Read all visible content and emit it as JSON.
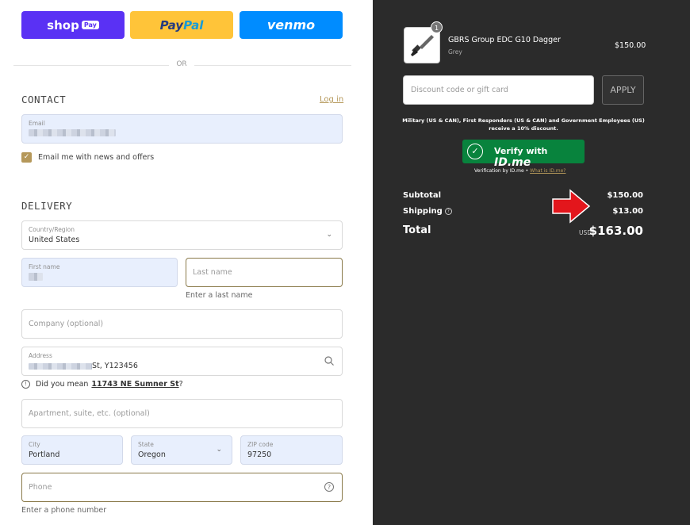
{
  "express": {
    "shop_label": "shop",
    "shop_pay_tag": "Pay",
    "paypal_pay": "Pay",
    "paypal_pal": "Pal",
    "venmo_label": "venmo",
    "or_text": "OR"
  },
  "contact": {
    "title": "CONTACT",
    "login_link": "Log in",
    "email_label": "Email",
    "newsletter_label": "Email me with news and offers",
    "newsletter_checked": true
  },
  "delivery": {
    "title": "DELIVERY",
    "country_label": "Country/Region",
    "country_value": "United States",
    "first_name_label": "First name",
    "last_name_placeholder": "Last name",
    "last_name_error": "Enter a last name",
    "company_placeholder": "Company (optional)",
    "address_label": "Address",
    "address_value_visible": "St, Y123456",
    "suggest_prefix": "Did you mean",
    "suggest_address": "11743 NE Sumner St",
    "suggest_suffix": "?",
    "apartment_placeholder": "Apartment, suite, etc. (optional)",
    "city_label": "City",
    "city_value": "Portland",
    "state_label": "State",
    "state_value": "Oregon",
    "zip_label": "ZIP code",
    "zip_value": "97250",
    "phone_placeholder": "Phone",
    "phone_error": "Enter a phone number"
  },
  "summary": {
    "product": {
      "quantity": "1",
      "name": "GBRS Group EDC G10 Dagger",
      "variant": "Grey",
      "price": "$150.00"
    },
    "discount_placeholder": "Discount code or gift card",
    "apply_label": "APPLY",
    "military_text": "Military (US & CAN), First Responders (US & CAN) and Government Employees (US) receive a 10% discount.",
    "idme_button_prefix": "Verify with",
    "idme_button_brand": "ID.me",
    "verification_text": "Verification by ID.me •",
    "what_is_idme": "What is ID.me?",
    "subtotal_label": "Subtotal",
    "subtotal_value": "$150.00",
    "shipping_label": "Shipping",
    "shipping_value": "$13.00",
    "total_label": "Total",
    "total_currency": "USD",
    "total_value": "$163.00"
  },
  "colors": {
    "shop_pay": "#5a31f4",
    "paypal": "#ffc439",
    "venmo": "#008cff",
    "accent_gold": "#b5985a",
    "summary_bg": "#2b2b2b",
    "idme_green": "#08833d",
    "arrow_red": "#e3161c"
  }
}
